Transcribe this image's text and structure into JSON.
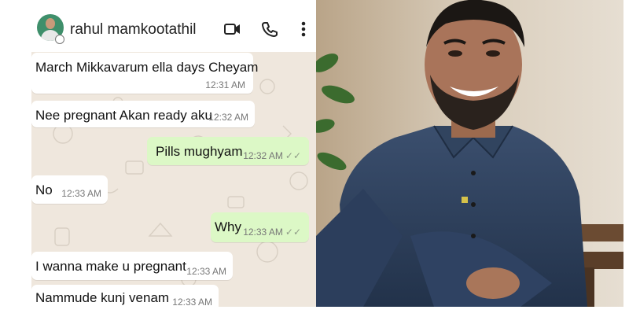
{
  "header": {
    "contact_name": "rahul mamkootathil",
    "avatar_icon": "contact-avatar",
    "icons": [
      "video-call-icon",
      "voice-call-icon",
      "more-options-icon"
    ]
  },
  "messages": [
    {
      "direction": "incoming",
      "text": "March Mikkavarum ella days Cheyam",
      "time": "12:31 AM"
    },
    {
      "direction": "incoming",
      "text": "Nee pregnant Akan ready aku",
      "time": "12:32 AM"
    },
    {
      "direction": "outgoing",
      "text": "Pills mughyam",
      "time": "12:32 AM",
      "status": "read-ticks"
    },
    {
      "direction": "incoming",
      "text": "No",
      "time": "12:33 AM"
    },
    {
      "direction": "outgoing",
      "text": "Why",
      "time": "12:33 AM",
      "status": "read-ticks"
    },
    {
      "direction": "incoming",
      "text": "I wanna make u pregnant",
      "time": "12:33 AM"
    },
    {
      "direction": "incoming",
      "text": "Nammude kunj venam",
      "time": "12:33 AM"
    }
  ],
  "colors": {
    "chat_background": "#efe7dd",
    "incoming_bubble": "#ffffff",
    "outgoing_bubble": "#dcf8c6",
    "read_ticks": "#8e9a86"
  }
}
